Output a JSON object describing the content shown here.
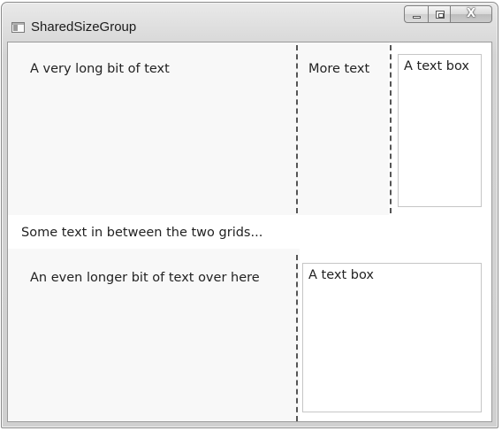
{
  "window": {
    "title": "SharedSizeGroup",
    "caption_buttons": {
      "minimize": "minimize",
      "maximize": "maximize",
      "close": "X"
    }
  },
  "top_grid": {
    "col1_text": "A very long bit of text",
    "col2_text": "More text",
    "textbox_value": "A text box"
  },
  "between_text": "Some text in between the two grids...",
  "bottom_grid": {
    "col1_text": "An even longer bit of text over here",
    "textbox_value": "A text box"
  }
}
